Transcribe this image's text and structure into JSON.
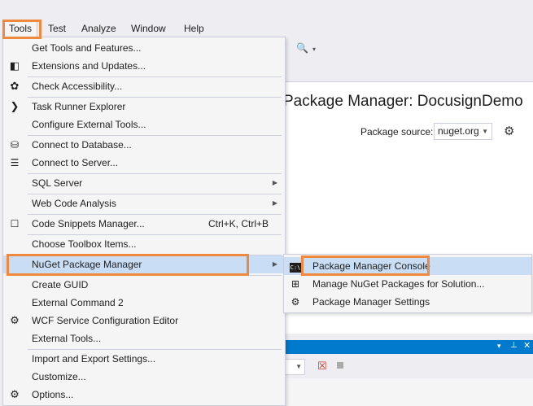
{
  "menubar": {
    "items": [
      "Tools",
      "Test",
      "Analyze",
      "Window",
      "Help"
    ]
  },
  "document": {
    "title": "Package Manager: DocusignDemo",
    "package_source_label": "Package source:",
    "package_source_value": "nuget.org"
  },
  "tools_menu": {
    "items": [
      {
        "label": "Get Tools and Features...",
        "icon": "none"
      },
      {
        "label": "Extensions and Updates...",
        "icon": "extensions-icon"
      },
      {
        "label": "Check Accessibility...",
        "icon": "accessibility-icon"
      },
      {
        "label": "Task Runner Explorer",
        "icon": "chevron-right-icon"
      },
      {
        "label": "Configure External Tools...",
        "icon": "none"
      },
      {
        "label": "Connect to Database...",
        "icon": "database-connect-icon"
      },
      {
        "label": "Connect to Server...",
        "icon": "server-connect-icon"
      },
      {
        "label": "SQL Server",
        "icon": "none",
        "submenu": true
      },
      {
        "label": "Web Code Analysis",
        "icon": "none",
        "submenu": true
      },
      {
        "label": "Code Snippets Manager...",
        "icon": "snippet-icon",
        "shortcut": "Ctrl+K, Ctrl+B"
      },
      {
        "label": "Choose Toolbox Items...",
        "icon": "none"
      },
      {
        "label": "NuGet Package Manager",
        "icon": "none",
        "submenu": true,
        "active": true
      },
      {
        "label": "Create GUID",
        "icon": "none"
      },
      {
        "label": "External Command 2",
        "icon": "none"
      },
      {
        "label": "WCF Service Configuration Editor",
        "icon": "wcf-gear-icon"
      },
      {
        "label": "External Tools...",
        "icon": "none"
      },
      {
        "label": "Import and Export Settings...",
        "icon": "none"
      },
      {
        "label": "Customize...",
        "icon": "none"
      },
      {
        "label": "Options...",
        "icon": "gear-icon"
      }
    ]
  },
  "nuget_submenu": {
    "items": [
      {
        "label": "Package Manager Console",
        "icon": "console-icon",
        "active": true
      },
      {
        "label": "Manage NuGet Packages for Solution...",
        "icon": "nuget-packages-icon"
      },
      {
        "label": "Package Manager Settings",
        "icon": "gear-icon"
      }
    ]
  },
  "colors": {
    "highlight_border": "#f0883e",
    "menu_active": "#c9def5",
    "panel_accent": "#007acc"
  }
}
